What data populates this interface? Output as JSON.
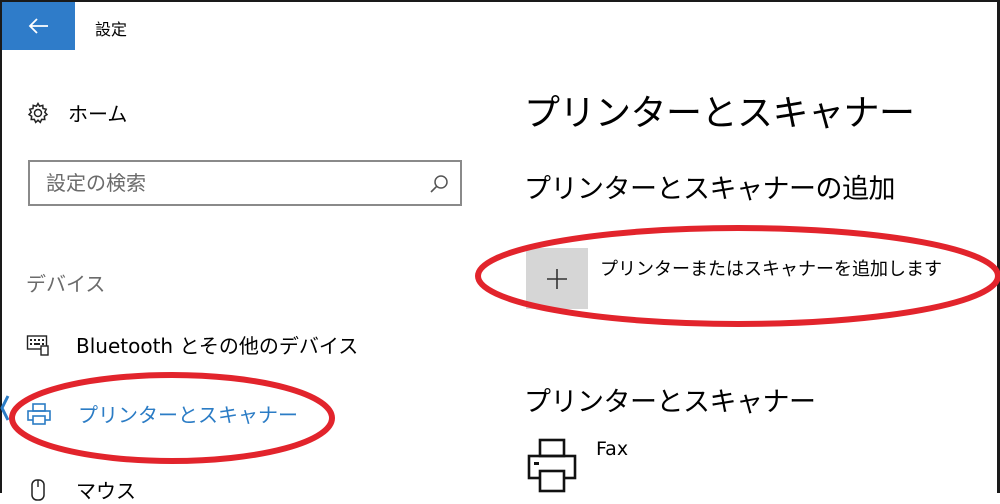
{
  "window": {
    "title": "設定"
  },
  "sidebar": {
    "home_label": "ホーム",
    "search": {
      "placeholder": "設定の検索",
      "value": ""
    },
    "section_label": "デバイス",
    "items": [
      {
        "label": "Bluetooth とその他のデバイス",
        "icon": "keyboard-icon"
      },
      {
        "label": "プリンターとスキャナー",
        "icon": "printer-icon",
        "selected": true
      },
      {
        "label": "マウス",
        "icon": "mouse-icon"
      }
    ]
  },
  "main": {
    "title": "プリンターとスキャナー",
    "add_section": {
      "heading": "プリンターとスキャナーの追加",
      "button_label": "プリンターまたはスキャナーを追加します"
    },
    "list_section": {
      "heading": "プリンターとスキャナー",
      "devices": [
        {
          "name": "Fax"
        }
      ]
    }
  },
  "colors": {
    "accent": "#2b7cc5",
    "back_button": "#2f7cc9",
    "annotation": "#e2242c"
  }
}
